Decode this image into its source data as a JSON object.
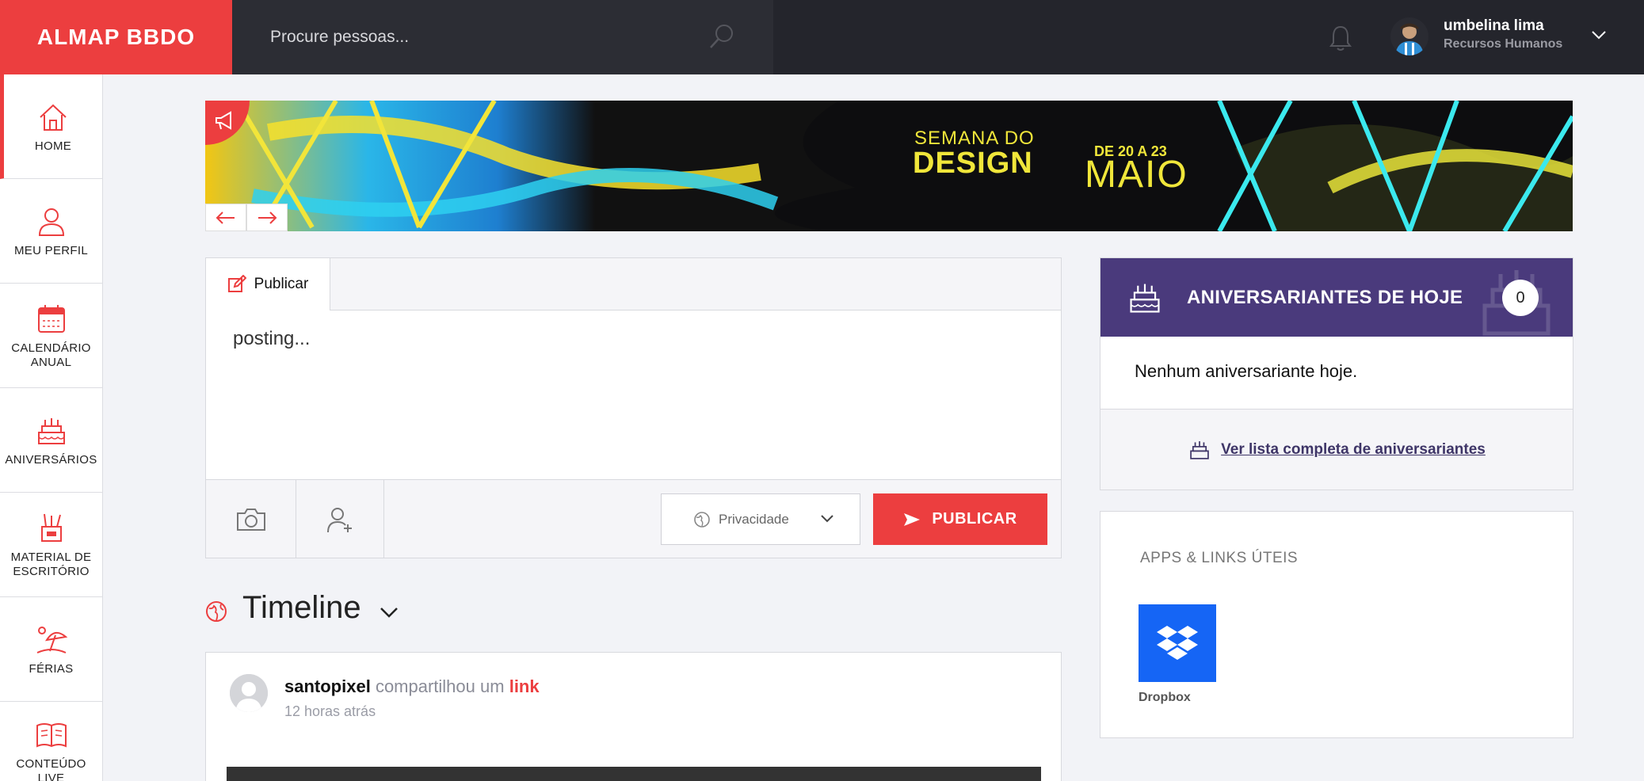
{
  "header": {
    "logo_text": "ALMAP BBDO",
    "search_placeholder": "Procure pessoas...",
    "user": {
      "name": "umbelina lima",
      "department": "Recursos Humanos"
    }
  },
  "sidebar": {
    "items": [
      {
        "label": "HOME",
        "icon": "home-icon",
        "active": true
      },
      {
        "label": "MEU PERFIL",
        "icon": "user-icon",
        "active": false
      },
      {
        "label": "CALENDÁRIO ANUAL",
        "icon": "calendar-icon",
        "active": false
      },
      {
        "label": "ANIVERSÁRIOS",
        "icon": "cake-icon",
        "active": false
      },
      {
        "label": "MATERIAL DE ESCRITÓRIO",
        "icon": "office-supplies-icon",
        "active": false
      },
      {
        "label": "FÉRIAS",
        "icon": "beach-icon",
        "active": false
      },
      {
        "label": "CONTEÚDO LIVE",
        "icon": "book-icon",
        "active": false
      }
    ]
  },
  "banner": {
    "line1": "SEMANA DO",
    "line2": "DESIGN",
    "line3": "DE 20 A 23",
    "line4": "MAIO"
  },
  "publish": {
    "tab_label": "Publicar",
    "text": "posting...",
    "privacy_label": "Privacidade",
    "button_label": "PUBLICAR"
  },
  "timeline": {
    "title": "Timeline",
    "post": {
      "author": "santopixel",
      "verb": "compartilhou um",
      "link_text": "link",
      "time": "12 horas atrás"
    }
  },
  "birthdays": {
    "title": "ANIVERSARIANTES DE HOJE",
    "count": "0",
    "empty_text": "Nenhum aniversariante hoje.",
    "link_text": "Ver lista completa de aniversariantes"
  },
  "apps": {
    "title": "APPS & LINKS ÚTEIS",
    "items": [
      {
        "label": "Dropbox",
        "icon": "dropbox-icon"
      }
    ]
  },
  "colors": {
    "brand_red": "#ec3e3f",
    "topbar": "#24252c",
    "birthday_header": "#4a3a7c",
    "dropbox_blue": "#1565f5"
  }
}
